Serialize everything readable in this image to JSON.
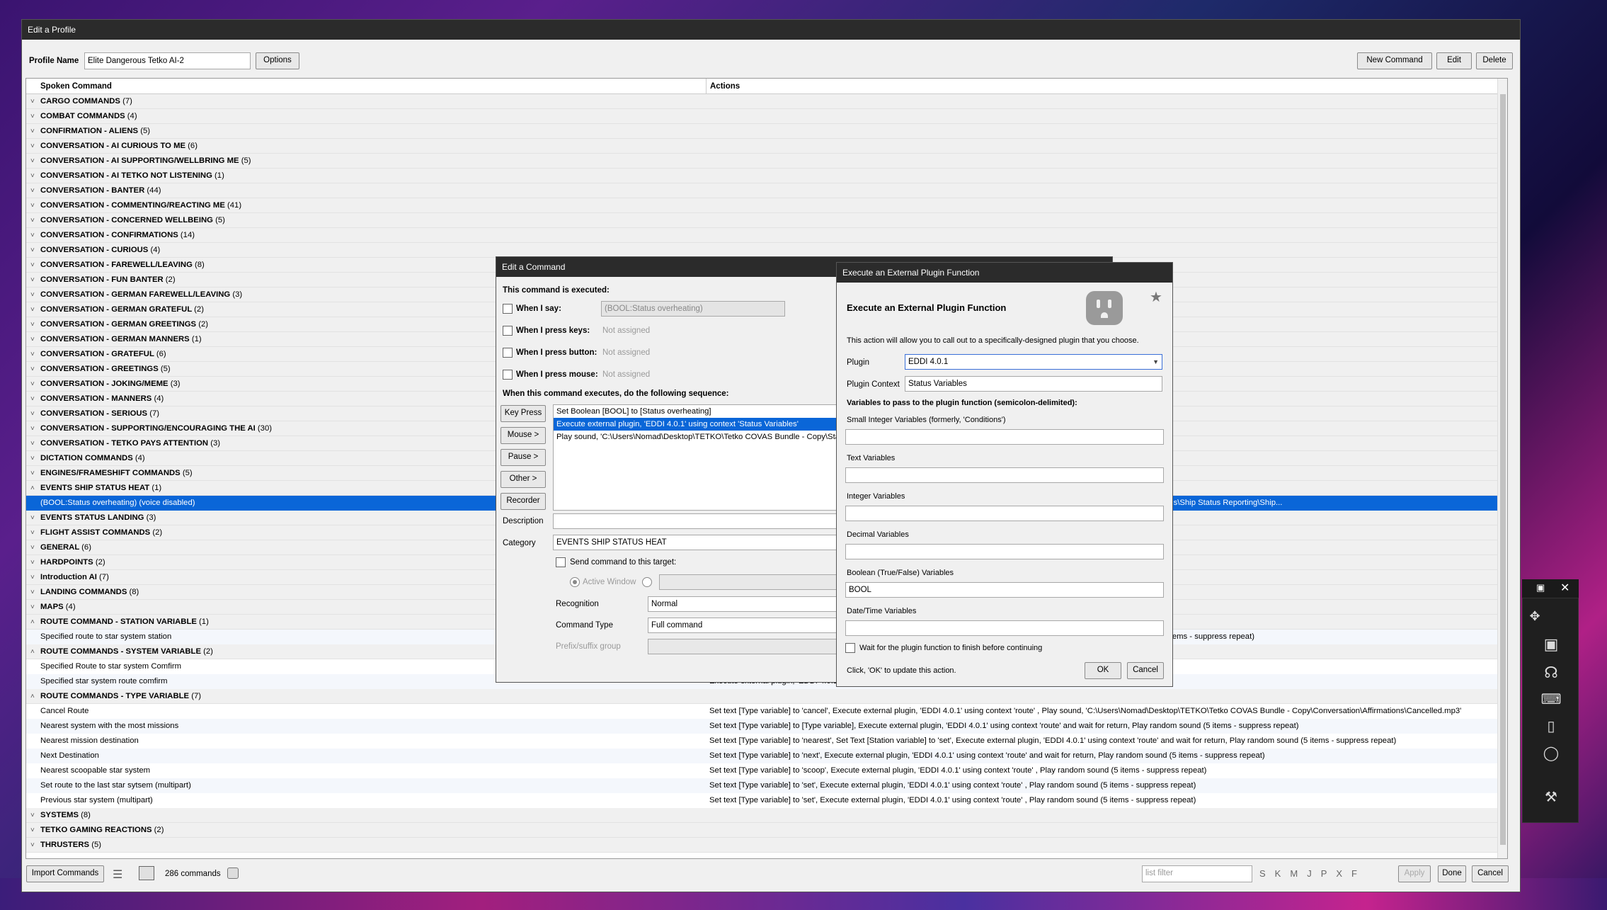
{
  "window": {
    "title": "Edit a Profile"
  },
  "profile": {
    "name_label": "Profile Name",
    "name_value": "Elite Dangerous Tetko AI-2",
    "options_label": "Options",
    "new_command_label": "New Command",
    "edit_label": "Edit",
    "delete_label": "Delete"
  },
  "grid": {
    "col_spoken": "Spoken Command",
    "col_actions": "Actions",
    "rows": [
      {
        "type": "group",
        "label": "CARGO COMMANDS",
        "count": "(7)"
      },
      {
        "type": "group",
        "label": "COMBAT COMMANDS",
        "count": "(4)"
      },
      {
        "type": "group",
        "label": "CONFIRMATION - ALIENS",
        "count": "(5)"
      },
      {
        "type": "group",
        "label": "CONVERSATION - AI CURIOUS TO ME",
        "count": "(6)"
      },
      {
        "type": "group",
        "label": "CONVERSATION - AI SUPPORTING/WELLBRING ME",
        "count": "(5)"
      },
      {
        "type": "group",
        "label": "CONVERSATION - AI TETKO NOT LISTENING",
        "count": "(1)"
      },
      {
        "type": "group",
        "label": "CONVERSATION - BANTER",
        "count": "(44)"
      },
      {
        "type": "group",
        "label": "CONVERSATION - COMMENTING/REACTING ME",
        "count": "(41)"
      },
      {
        "type": "group",
        "label": "CONVERSATION - CONCERNED WELLBEING",
        "count": "(5)"
      },
      {
        "type": "group",
        "label": "CONVERSATION - CONFIRMATIONS",
        "count": "(14)"
      },
      {
        "type": "group",
        "label": "CONVERSATION - CURIOUS",
        "count": "(4)"
      },
      {
        "type": "group",
        "label": "CONVERSATION - FAREWELL/LEAVING",
        "count": "(8)"
      },
      {
        "type": "group",
        "label": "CONVERSATION - FUN BANTER",
        "count": "(2)"
      },
      {
        "type": "group",
        "label": "CONVERSATION - GERMAN FAREWELL/LEAVING",
        "count": "(3)"
      },
      {
        "type": "group",
        "label": "CONVERSATION - GERMAN GRATEFUL",
        "count": "(2)"
      },
      {
        "type": "group",
        "label": "CONVERSATION - GERMAN GREETINGS",
        "count": "(2)"
      },
      {
        "type": "group",
        "label": "CONVERSATION - GERMAN MANNERS",
        "count": "(1)"
      },
      {
        "type": "group",
        "label": "CONVERSATION - GRATEFUL",
        "count": "(6)"
      },
      {
        "type": "group",
        "label": "CONVERSATION - GREETINGS",
        "count": "(5)"
      },
      {
        "type": "group",
        "label": "CONVERSATION - JOKING/MEME",
        "count": "(3)"
      },
      {
        "type": "group",
        "label": "CONVERSATION - MANNERS",
        "count": "(4)"
      },
      {
        "type": "group",
        "label": "CONVERSATION - SERIOUS",
        "count": "(7)"
      },
      {
        "type": "group",
        "label": "CONVERSATION - SUPPORTING/ENCOURAGING THE AI",
        "count": "(30)"
      },
      {
        "type": "group",
        "label": "CONVERSATION - TETKO PAYS ATTENTION",
        "count": "(3)"
      },
      {
        "type": "group",
        "label": "DICTATION COMMANDS",
        "count": "(4)"
      },
      {
        "type": "group",
        "label": "ENGINES/FRAMESHIFT COMMANDS",
        "count": "(5)"
      },
      {
        "type": "group",
        "label": "EVENTS SHIP STATUS HEAT",
        "count": "(1)",
        "open": true
      },
      {
        "type": "item",
        "label": "(BOOL:Status overheating)  (voice disabled)",
        "action": "rs\\Nomad\\Desktop\\TETKO\\Tetko COVAS Bundle - Copy\\Status\\Ship Status Reporting\\Ship...",
        "selected": true
      },
      {
        "type": "group",
        "label": "EVENTS STATUS LANDING",
        "count": "(3)"
      },
      {
        "type": "group",
        "label": "FLIGHT ASSIST COMMANDS",
        "count": "(2)"
      },
      {
        "type": "group",
        "label": "GENERAL",
        "count": "(6)"
      },
      {
        "type": "group",
        "label": "HARDPOINTS",
        "count": "(2)"
      },
      {
        "type": "group",
        "label": "Introduction AI",
        "count": "(7)"
      },
      {
        "type": "group",
        "label": "LANDING COMMANDS",
        "count": "(8)"
      },
      {
        "type": "group",
        "label": "MAPS",
        "count": "(4)"
      },
      {
        "type": "group",
        "label": "ROUTE COMMAND - STATION VARIABLE",
        "count": "(1)",
        "open": true
      },
      {
        "type": "item",
        "label": "Specified route to star system station",
        "action": "(5 items - suppress repeat)",
        "actionOffset": 1045
      },
      {
        "type": "group",
        "label": "ROUTE COMMANDS - SYSTEM VARIABLE",
        "count": "(2)",
        "open": true
      },
      {
        "type": "item",
        "label": "Specified Route to star system Comfirm",
        "action": ""
      },
      {
        "type": "item",
        "label": "Specified star system route comfirm",
        "action": "Execute external plugin, 'EDDI 4.0.1'"
      },
      {
        "type": "group",
        "label": "ROUTE COMMANDS - TYPE VARIABLE",
        "count": "(7)",
        "open": true
      },
      {
        "type": "item",
        "label": "Cancel Route",
        "action": "Set text [Type variable] to 'cancel', Execute external plugin, 'EDDI 4.0.1' using context 'route' , Play sound, 'C:\\Users\\Nomad\\Desktop\\TETKO\\Tetko COVAS Bundle - Copy\\Conversation\\Affirmations\\Cancelled.mp3'"
      },
      {
        "type": "item",
        "label": "Nearest system with the most missions",
        "action": "Set text [Type variable] to [Type variable], Execute external plugin, 'EDDI 4.0.1' using context 'route' and wait for return, Play random sound (5 items - suppress repeat)"
      },
      {
        "type": "item",
        "label": "Nearest mission destination",
        "action": "Set text [Type variable] to 'nearest', Set Text [Station variable] to 'set', Execute external plugin, 'EDDI 4.0.1' using context 'route' and wait for return, Play random sound (5 items - suppress repeat)"
      },
      {
        "type": "item",
        "label": "Next Destination",
        "action": "Set text [Type variable] to 'next', Execute external plugin, 'EDDI 4.0.1' using context 'route' and wait for return, Play random sound (5 items - suppress repeat)"
      },
      {
        "type": "item",
        "label": "Nearest scoopable star system",
        "action": "Set text [Type variable] to 'scoop', Execute external plugin, 'EDDI 4.0.1' using context 'route' , Play random sound (5 items - suppress repeat)"
      },
      {
        "type": "item",
        "label": "Set route to the last star sytsem (multipart)",
        "action": "Set text [Type variable] to 'set', Execute external plugin, 'EDDI 4.0.1' using context 'route' , Play random sound (5 items - suppress repeat)"
      },
      {
        "type": "item",
        "label": " Previous star system (multipart)",
        "action": "Set text [Type variable] to 'set', Execute external plugin, 'EDDI 4.0.1' using context 'route' , Play random sound (5 items - suppress repeat)"
      },
      {
        "type": "group",
        "label": "SYSTEMS",
        "count": "(8)"
      },
      {
        "type": "group",
        "label": "TETKO GAMING REACTIONS",
        "count": "(2)"
      },
      {
        "type": "group",
        "label": "THRUSTERS",
        "count": "(5)"
      }
    ]
  },
  "footer": {
    "import_label": "Import Commands",
    "count_text": "286 commands",
    "filter_placeholder": "list filter",
    "letters": [
      "S",
      "K",
      "M",
      "J",
      "P",
      "X",
      "F"
    ],
    "apply_label": "Apply",
    "done_label": "Done",
    "cancel_label": "Cancel"
  },
  "edit_command": {
    "title": "Edit a Command",
    "executed_label": "This command is executed:",
    "when_say": "When I say:",
    "say_value": "(BOOL:Status overheating)",
    "when_keys": "When I press keys:",
    "keys_value": "Not assigned",
    "when_button": "When I press button:",
    "button_value": "Not assigned",
    "when_mouse": "When I press mouse:",
    "mouse_value": "Not assigned",
    "sequence_label": "When this command executes, do the following sequence:",
    "btn_keypress": "Key Press",
    "btn_mouse": "Mouse >",
    "btn_pause": "Pause >",
    "btn_other": "Other >",
    "btn_recorder": "Recorder",
    "sequence": [
      "Set Boolean [BOOL] to [Status overheating]",
      "Execute external plugin, 'EDDI 4.0.1' using context 'Status Variables'",
      "Play sound, 'C:\\Users\\Nomad\\Desktop\\TETKO\\Tetko COVAS Bundle - Copy\\Status"
    ],
    "description_label": "Description",
    "category_label": "Category",
    "category_value": "EVENTS SHIP STATUS HEAT",
    "send_target": "Send command to this target:",
    "active_window": "Active Window",
    "recognition_label": "Recognition",
    "recognition_value": "Normal",
    "command_type_label": "Command Type",
    "command_type_value": "Full command",
    "prefix_label": "Prefix/suffix group"
  },
  "plugin_dialog": {
    "title": "Execute an External Plugin Function",
    "heading": "Execute an External Plugin Function",
    "intro": "This action will allow you to call out to a specifically-designed plugin that you choose.",
    "plugin_label": "Plugin",
    "plugin_value": "EDDI 4.0.1",
    "context_label": "Plugin Context",
    "context_value": "Status Variables",
    "vars_label": "Variables to pass to the plugin function (semicolon-delimited):",
    "small_int_label": "Small Integer Variables (formerly, 'Conditions')",
    "small_int_value": "",
    "text_label": "Text Variables",
    "text_value": "",
    "int_label": "Integer Variables",
    "int_value": "",
    "decimal_label": "Decimal Variables",
    "decimal_value": "",
    "bool_label": "Boolean (True/False) Variables",
    "bool_value": "BOOL",
    "datetime_label": "Date/Time Variables",
    "datetime_value": "",
    "wait_label": "Wait for the plugin function to finish before continuing",
    "click_ok_text": "Click, 'OK' to update this action.",
    "ok_label": "OK",
    "cancel_label": "Cancel"
  },
  "colors": {
    "selection": "#0a66d8",
    "titlebar": "#2b2b2b"
  }
}
